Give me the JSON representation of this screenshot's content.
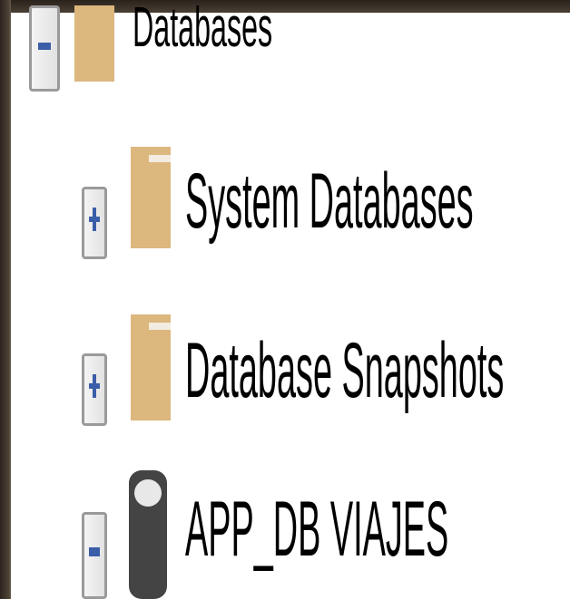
{
  "object_explorer": {
    "root": {
      "label": "Databases",
      "state": "expanded",
      "icon": "folder-icon",
      "children": [
        {
          "label": "System Databases",
          "state": "collapsed",
          "icon": "folder-icon"
        },
        {
          "label": "Database Snapshots",
          "state": "collapsed",
          "icon": "folder-icon"
        },
        {
          "label": "APP_DB VIAJES",
          "state": "expanded",
          "icon": "database-icon"
        }
      ]
    }
  },
  "colors": {
    "folder": "#dcb77e",
    "expander_sign": "#3b5ea8",
    "database_icon": "#444444"
  }
}
